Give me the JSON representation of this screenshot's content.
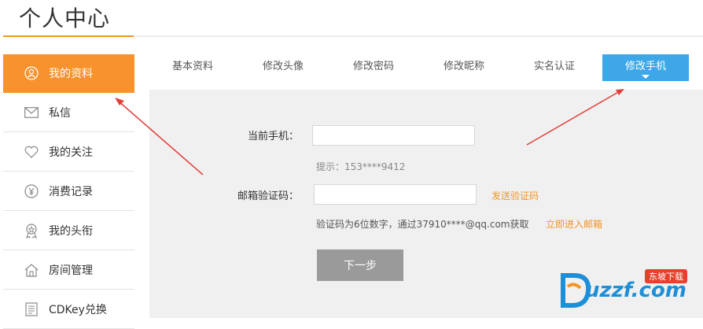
{
  "header": {
    "title": "个人中心"
  },
  "sidebar": {
    "items": [
      {
        "label": "我的资料",
        "icon": "user-icon",
        "active": true
      },
      {
        "label": "私信",
        "icon": "mail-icon",
        "active": false
      },
      {
        "label": "我的关注",
        "icon": "heart-icon",
        "active": false
      },
      {
        "label": "消费记录",
        "icon": "yen-icon",
        "active": false
      },
      {
        "label": "我的头衔",
        "icon": "medal-icon",
        "active": false
      },
      {
        "label": "房间管理",
        "icon": "home-icon",
        "active": false
      },
      {
        "label": "CDKey兑换",
        "icon": "document-icon",
        "active": false
      }
    ]
  },
  "tabs": {
    "items": [
      {
        "label": "基本资料"
      },
      {
        "label": "修改头像"
      },
      {
        "label": "修改密码"
      },
      {
        "label": "修改昵称"
      },
      {
        "label": "实名认证"
      },
      {
        "label": "修改手机"
      }
    ],
    "active_index": 5
  },
  "form": {
    "phone_label": "当前手机：",
    "phone_value": "",
    "phone_hint": "提示：153****9412",
    "code_label": "邮箱验证码：",
    "code_value": "",
    "send_code_link": "发送验证码",
    "code_hint": "验证码为6位数字，通过37910****@qq.com获取",
    "enter_mail_link": "立即进入邮箱",
    "next_button": "下一步"
  },
  "watermark": {
    "text": "uzzf.com",
    "badge": "东坡下载"
  },
  "colors": {
    "accent": "#f7922c",
    "tab_active": "#3da7e8",
    "arrow": "#e0403a"
  }
}
